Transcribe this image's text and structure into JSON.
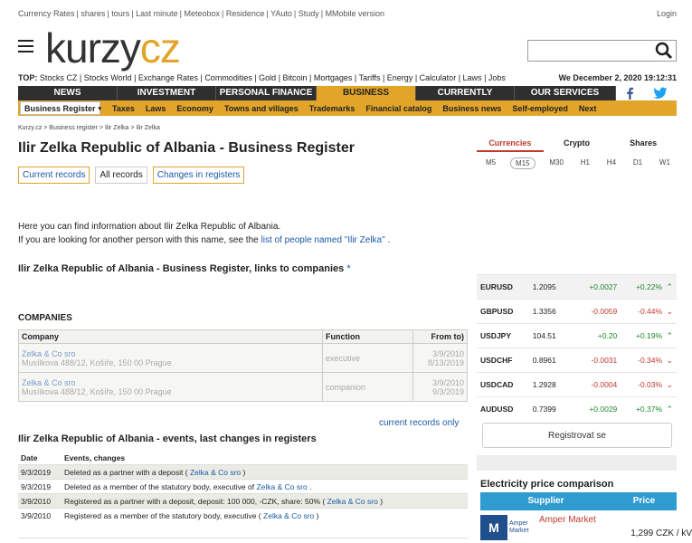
{
  "topbar": {
    "links": [
      "Currency Rates",
      "shares",
      "tours",
      "Last minute",
      "Meteobox",
      "Residence",
      "YAuto",
      "Study",
      "M"
    ],
    "mobile": "Mobile version",
    "login": "Login"
  },
  "logo": {
    "main": "kurzy",
    "accent": "cz"
  },
  "top": {
    "label": "TOP:",
    "items": [
      "Stocks CZ",
      "Stocks World",
      "Exchange Rates",
      "Commodities",
      "Gold",
      "Bitcoin",
      "Mortgages",
      "Tariffs",
      "Energy",
      "Calculator",
      "Laws",
      "Jobs"
    ],
    "date": "We December 2, 2020 19:12:31"
  },
  "mainnav": [
    "NEWS",
    "INVESTMENT",
    "PERSONAL FINANCE",
    "BUSINESS",
    "CURRENTLY",
    "OUR SERVICES"
  ],
  "subnav": [
    "Business Register",
    "Taxes",
    "Laws",
    "Economy",
    "Towns and villages",
    "Trademarks",
    "Financial catalog",
    "Business news",
    "Self-employed",
    "Next"
  ],
  "breadcrumb": "Kurzy.cz > Business register > Ilir Zelka > Ilir Zelka",
  "page_title": "Ilir Zelka Republic of Albania - Business Register",
  "tabs": [
    "Current records",
    "All records",
    "Changes in registers"
  ],
  "intro": {
    "line1": "Here you can find information about Ilir Zelka Republic of Albania.",
    "line2_pre": "If you are looking for another person with this name, see the",
    "line2_link": "list of people named \"Ilir Zelka\"",
    "line2_post": "."
  },
  "links_heading": "Ilir Zelka Republic of Albania - Business Register, links to companies",
  "links_asterisk": "*",
  "companies": {
    "heading": "COMPANIES",
    "headers": [
      "Company",
      "Function",
      "From to)"
    ],
    "rows": [
      {
        "name": "Zelka & Co sro",
        "address": "Musílkova 488/12, Košíře, 150 00 Prague",
        "function": "executive",
        "from": "3/9/2010",
        "to": "8/13/2019"
      },
      {
        "name": "Zelka & Co sro",
        "address": "Musílkova 488/12, Košíře, 150 00 Prague",
        "function": "companion",
        "from": "3/9/2010",
        "to": "9/3/2019"
      }
    ]
  },
  "current_only": "current records only",
  "events": {
    "heading": "Ilir Zelka Republic of Albania - events, last changes in registers",
    "headers": [
      "Date",
      "Events, changes"
    ],
    "rows": [
      {
        "date": "9/3/2019",
        "pre": "Deleted as a partner with a deposit (",
        "link": "Zelka & Co sro",
        "post": ")"
      },
      {
        "date": "9/3/2019",
        "pre": "Deleted as a member of the statutory body, executive of",
        "link": "Zelka & Co sro",
        "post": "."
      },
      {
        "date": "3/9/2010",
        "pre": "Registered as a partner with a deposit, deposit: 100 000, -CZK, share: 50% (",
        "link": "Zelka & Co sro",
        "post": ")"
      },
      {
        "date": "3/9/2010",
        "pre": "Registered as a member of the statutory body, executive (",
        "link": "Zelka & Co sro",
        "post": ")"
      }
    ]
  },
  "right": {
    "tabs": [
      "Currencies",
      "Crypto",
      "Shares"
    ],
    "timeframes": [
      "M5",
      "M15",
      "M30",
      "H1",
      "H4",
      "D1",
      "W1"
    ],
    "rates": [
      {
        "pair": "EURUSD",
        "value": "1.2095",
        "change": "+0.0027",
        "percent": "+0.22%",
        "dir": "up"
      },
      {
        "pair": "GBPUSD",
        "value": "1.3356",
        "change": "-0.0059",
        "percent": "-0.44%",
        "dir": "down"
      },
      {
        "pair": "USDJPY",
        "value": "104.51",
        "change": "+0.20",
        "percent": "+0.19%",
        "dir": "up"
      },
      {
        "pair": "USDCHF",
        "value": "0.8961",
        "change": "-0.0031",
        "percent": "-0.34%",
        "dir": "down"
      },
      {
        "pair": "USDCAD",
        "value": "1.2928",
        "change": "-0.0004",
        "percent": "-0.03%",
        "dir": "down"
      },
      {
        "pair": "AUDUSD",
        "value": "0.7399",
        "change": "+0.0029",
        "percent": "+0.37%",
        "dir": "up"
      }
    ],
    "register_button": "Registrovat se",
    "electricity": {
      "heading": "Electricity price comparison",
      "headers": [
        "Supplier",
        "Price"
      ],
      "supplier_logo_text": "Amper Market",
      "supplier": "Amper Market",
      "price": "1,299 CZK / kV"
    }
  },
  "colors": {
    "accent": "#e2a52a",
    "nav": "#2f2f2f",
    "link": "#1a5aa6",
    "positive": "#1e8a2a",
    "negative": "#c0392b",
    "elec_header": "#2e9bd1"
  }
}
